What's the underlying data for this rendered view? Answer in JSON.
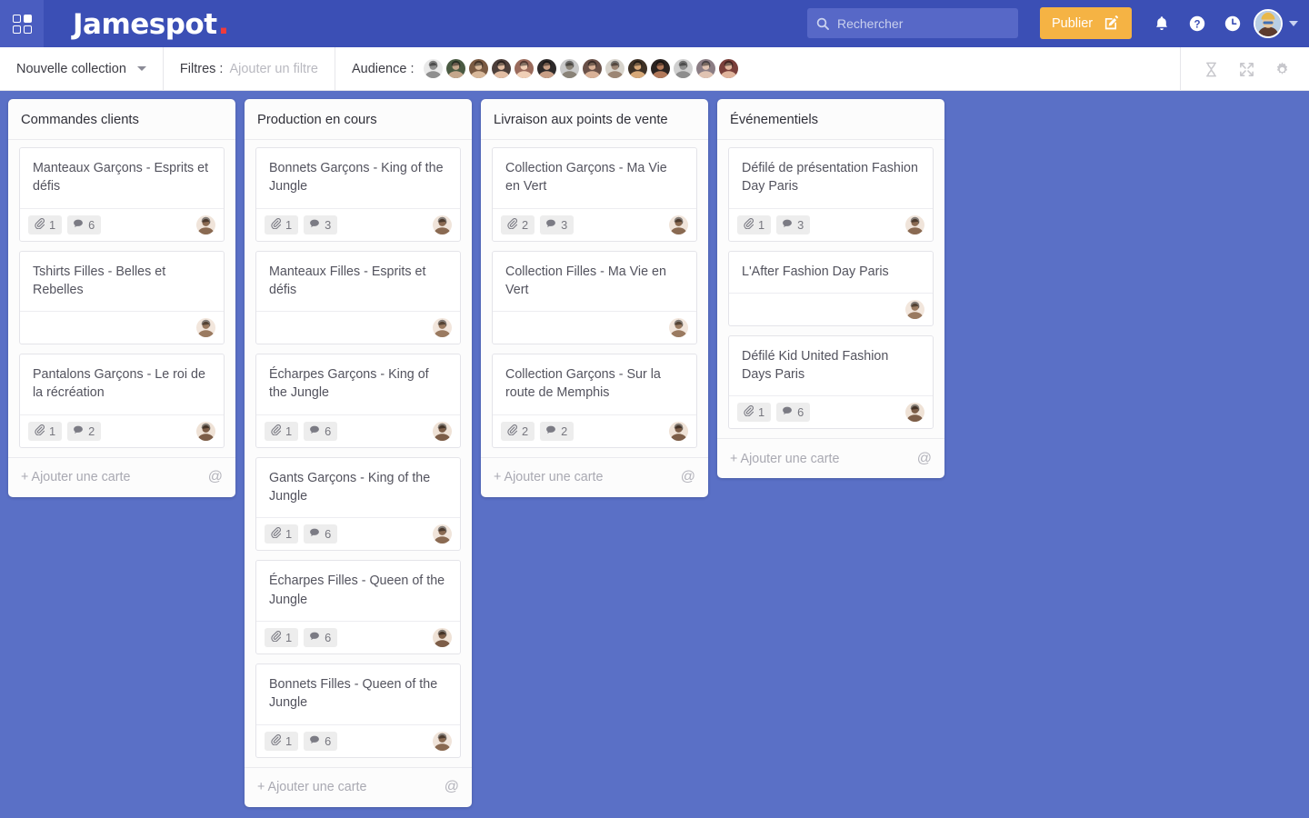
{
  "header": {
    "grid_icon": "grid-apps-icon",
    "brand": "Jamespot",
    "brand_dot": ".",
    "search": {
      "icon": "search-icon",
      "placeholder": "Rechercher",
      "value": ""
    },
    "publish_button": {
      "label": "Publier",
      "icon": "compose-icon",
      "color": "#f5b344"
    },
    "icons": [
      {
        "name": "notifications-bell-icon"
      },
      {
        "name": "help-question-icon"
      },
      {
        "name": "history-clock-icon"
      }
    ],
    "avatar": {
      "name": "user-avatar",
      "caret": "chevron-down-icon"
    }
  },
  "filterbar": {
    "collection": {
      "label": "Nouvelle collection",
      "caret": "chevron-down-icon"
    },
    "filters": {
      "label": "Filtres :",
      "placeholder": "Ajouter un filtre"
    },
    "audience": {
      "label": "Audience :",
      "count": 14,
      "avatars": [
        {
          "name": "audience-avatar-1",
          "bg": "#e9e9e9",
          "fg": "#8f8f8f"
        },
        {
          "name": "audience-avatar-2",
          "bg": "#4a5a42",
          "fg": "#c4a78c"
        },
        {
          "name": "audience-avatar-3",
          "bg": "#7a5a42",
          "fg": "#d8b89a"
        },
        {
          "name": "audience-avatar-4",
          "bg": "#4d3f3a",
          "fg": "#e2bda3"
        },
        {
          "name": "audience-avatar-5",
          "bg": "#9a6b5c",
          "fg": "#f0cfb6"
        },
        {
          "name": "audience-avatar-6",
          "bg": "#2e2a2a",
          "fg": "#c89f86"
        },
        {
          "name": "audience-avatar-7",
          "bg": "#c9c9c9",
          "fg": "#8a8378"
        },
        {
          "name": "audience-avatar-8",
          "bg": "#6a5148",
          "fg": "#d9b197"
        },
        {
          "name": "audience-avatar-9",
          "bg": "#d8d4cc",
          "fg": "#9c8674"
        },
        {
          "name": "audience-avatar-10",
          "bg": "#3f3226",
          "fg": "#d6a878"
        },
        {
          "name": "audience-avatar-11",
          "bg": "#2b2320",
          "fg": "#b2795a"
        },
        {
          "name": "audience-avatar-12",
          "bg": "#cfcfcf",
          "fg": "#8e8e8e"
        },
        {
          "name": "audience-avatar-13",
          "bg": "#8b7d84",
          "fg": "#e0c3b2"
        },
        {
          "name": "audience-avatar-14",
          "bg": "#7a3f3a",
          "fg": "#e0b49c"
        }
      ]
    },
    "tools": [
      {
        "name": "hourglass-icon"
      },
      {
        "name": "fullscreen-expand-icon"
      },
      {
        "name": "settings-gear-icon"
      }
    ]
  },
  "board": {
    "add_card_label": "+ Ajouter une carte",
    "mention_icon": "@",
    "columns": [
      {
        "title": "Commandes clients",
        "cards": [
          {
            "title": "Manteaux Garçons - Esprits et défis",
            "attachments": "1",
            "comments": "6",
            "avatar_bg": "#f0e4da",
            "avatar_fg": "#8a6a52"
          },
          {
            "title": "Tshirts Filles - Belles et Rebelles",
            "attachments": null,
            "comments": null,
            "avatar_bg": "#f2e6dc",
            "avatar_fg": "#9a7a60"
          },
          {
            "title": "Pantalons Garçons - Le roi de la récréation",
            "attachments": "1",
            "comments": "2",
            "avatar_bg": "#efe2d6",
            "avatar_fg": "#7d5e48"
          }
        ]
      },
      {
        "title": "Production en cours",
        "cards": [
          {
            "title": "Bonnets Garçons - King of the Jungle",
            "attachments": "1",
            "comments": "3",
            "avatar_bg": "#f0e4da",
            "avatar_fg": "#8a6a52"
          },
          {
            "title": "Manteaux Filles - Esprits et défis",
            "attachments": null,
            "comments": null,
            "avatar_bg": "#f2e6dc",
            "avatar_fg": "#9a7a60"
          },
          {
            "title": "Écharpes Garçons - King of the Jungle",
            "attachments": "1",
            "comments": "6",
            "avatar_bg": "#efe2d6",
            "avatar_fg": "#7d5e48"
          },
          {
            "title": "Gants Garçons - King of the Jungle",
            "attachments": "1",
            "comments": "6",
            "avatar_bg": "#f0e4da",
            "avatar_fg": "#8a6a52"
          },
          {
            "title": "Écharpes Filles - Queen of the Jungle",
            "attachments": "1",
            "comments": "6",
            "avatar_bg": "#efe2d6",
            "avatar_fg": "#7d5e48"
          },
          {
            "title": "Bonnets Filles - Queen of the Jungle",
            "attachments": "1",
            "comments": "6",
            "avatar_bg": "#f0e4da",
            "avatar_fg": "#8a6a52"
          }
        ]
      },
      {
        "title": "Livraison aux points de vente",
        "cards": [
          {
            "title": "Collection Garçons - Ma Vie en Vert",
            "attachments": "2",
            "comments": "3",
            "avatar_bg": "#f0e4da",
            "avatar_fg": "#8a6a52"
          },
          {
            "title": "Collection Filles - Ma Vie en Vert",
            "attachments": null,
            "comments": null,
            "avatar_bg": "#f2e6dc",
            "avatar_fg": "#9a7a60"
          },
          {
            "title": "Collection Garçons - Sur la route de Memphis",
            "attachments": "2",
            "comments": "2",
            "avatar_bg": "#efe2d6",
            "avatar_fg": "#7d5e48"
          }
        ]
      },
      {
        "title": "Événementiels",
        "cards": [
          {
            "title": "Défilé de présentation Fashion Day Paris",
            "attachments": "1",
            "comments": "3",
            "avatar_bg": "#f0e4da",
            "avatar_fg": "#8a6a52"
          },
          {
            "title": "L'After Fashion Day Paris",
            "attachments": null,
            "comments": null,
            "avatar_bg": "#f2e6dc",
            "avatar_fg": "#9a7a60"
          },
          {
            "title": "Défilé Kid United Fashion Days Paris",
            "attachments": "1",
            "comments": "6",
            "avatar_bg": "#efe2d6",
            "avatar_fg": "#7d5e48"
          }
        ]
      }
    ]
  },
  "colors": {
    "header_bg": "#3b4fb5",
    "board_bg": "#5a70c6",
    "accent": "#f5b344",
    "brand_dot": "#ef3b3b"
  }
}
